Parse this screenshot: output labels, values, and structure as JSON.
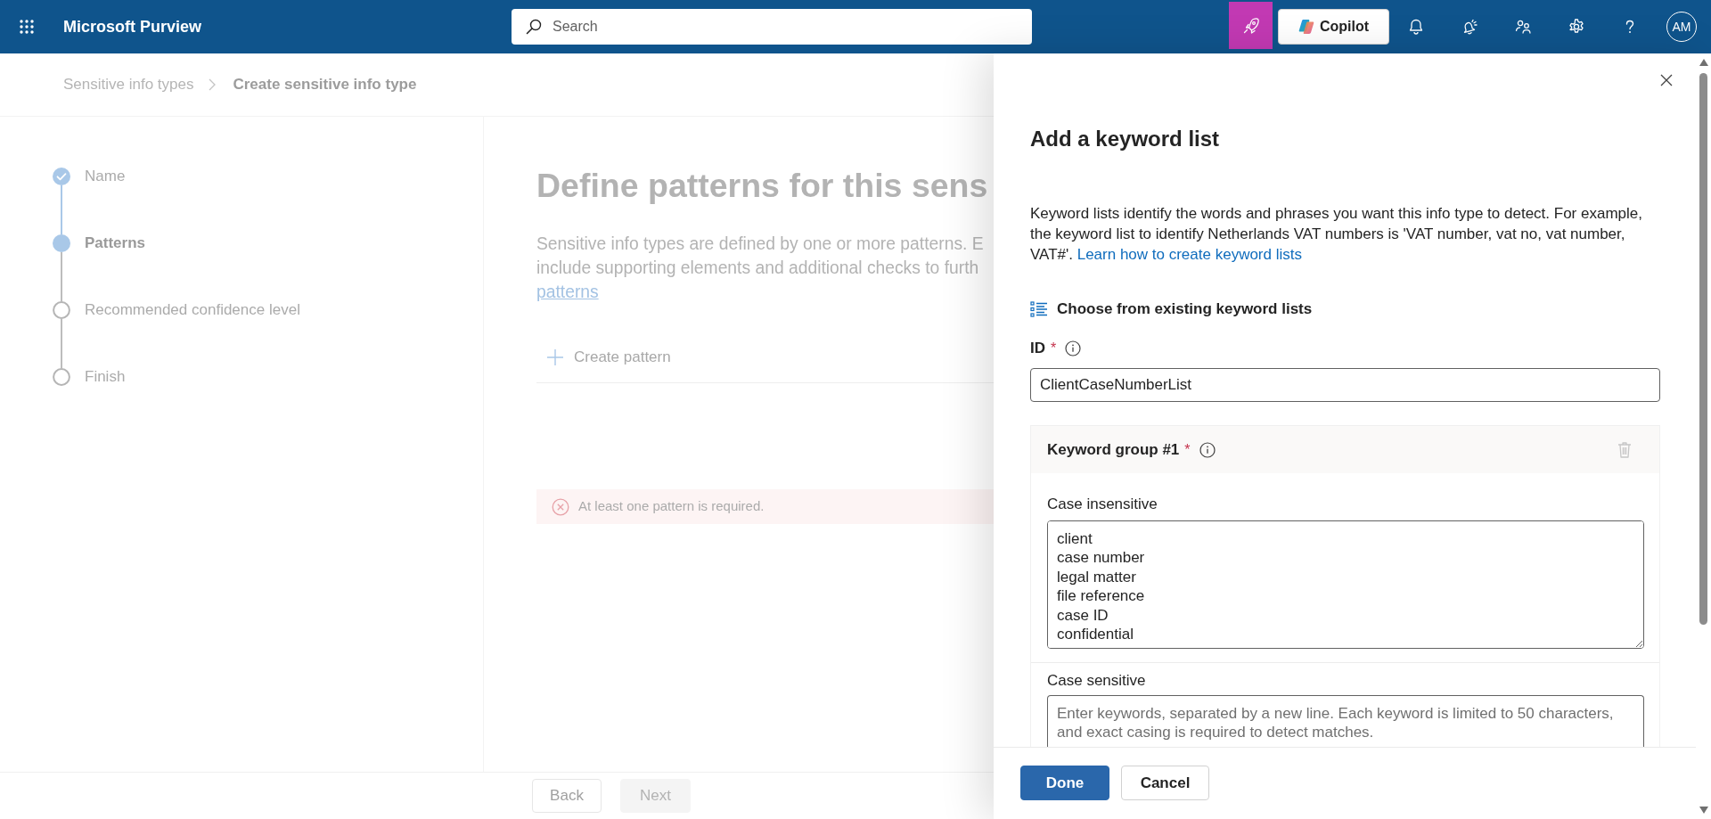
{
  "app_bar": {
    "title": "Microsoft Purview",
    "search": {
      "placeholder": "Search"
    },
    "copilot": "Copilot",
    "avatar": "AM"
  },
  "breadcrumb": [
    {
      "label": "Sensitive info types",
      "current": false
    },
    {
      "label": "Create sensitive info type",
      "current": true
    }
  ],
  "steps": [
    {
      "label": "Name",
      "completed": true,
      "selected": false
    },
    {
      "label": "Patterns",
      "completed": false,
      "selected": true
    },
    {
      "label": "Recommended confidence level",
      "completed": false,
      "selected": false
    },
    {
      "label": "Finish",
      "completed": false,
      "selected": false
    }
  ],
  "main": {
    "title": "Define patterns for this sens",
    "description": {
      "lines": [
        "Sensitive info types are defined by one or more patterns. E",
        "include supporting elements and additional checks to furth"
      ],
      "link": "patterns"
    },
    "create_button": "Create pattern",
    "error": "At least one pattern is required."
  },
  "wizard_buttons": [
    {
      "label": "Back",
      "disabled": false
    },
    {
      "label": "Next",
      "disabled": true
    }
  ],
  "panel": {
    "title": "Add a keyword list",
    "description": "Keyword lists identify the words and phrases you want this info type to detect. For example, the keyword list to identify Netherlands VAT numbers is 'VAT number, vat no, vat number, VAT#'.",
    "link": "Learn how to create keyword lists",
    "choose_button": "Choose from existing keyword lists",
    "id_field": {
      "label": "ID",
      "required_mark": "*",
      "value": "ClientCaseNumberList"
    },
    "keyword_groups": [
      {
        "title": "Keyword group #1",
        "required_mark": "*",
        "delete_disabled": true,
        "fields": [
          {
            "label": "Case insensitive",
            "value": "client\ncase number\nlegal matter\nfile reference\ncase ID\nconfidential"
          },
          {
            "label": "Case sensitive",
            "placeholder": "Enter keywords, separated by a new line. Each keyword is limited to 50 characters, and exact casing is required to detect matches."
          }
        ]
      }
    ],
    "buttons": [
      {
        "label": "Done",
        "kind": "primary"
      },
      {
        "label": "Cancel",
        "kind": "secondary"
      }
    ]
  }
}
